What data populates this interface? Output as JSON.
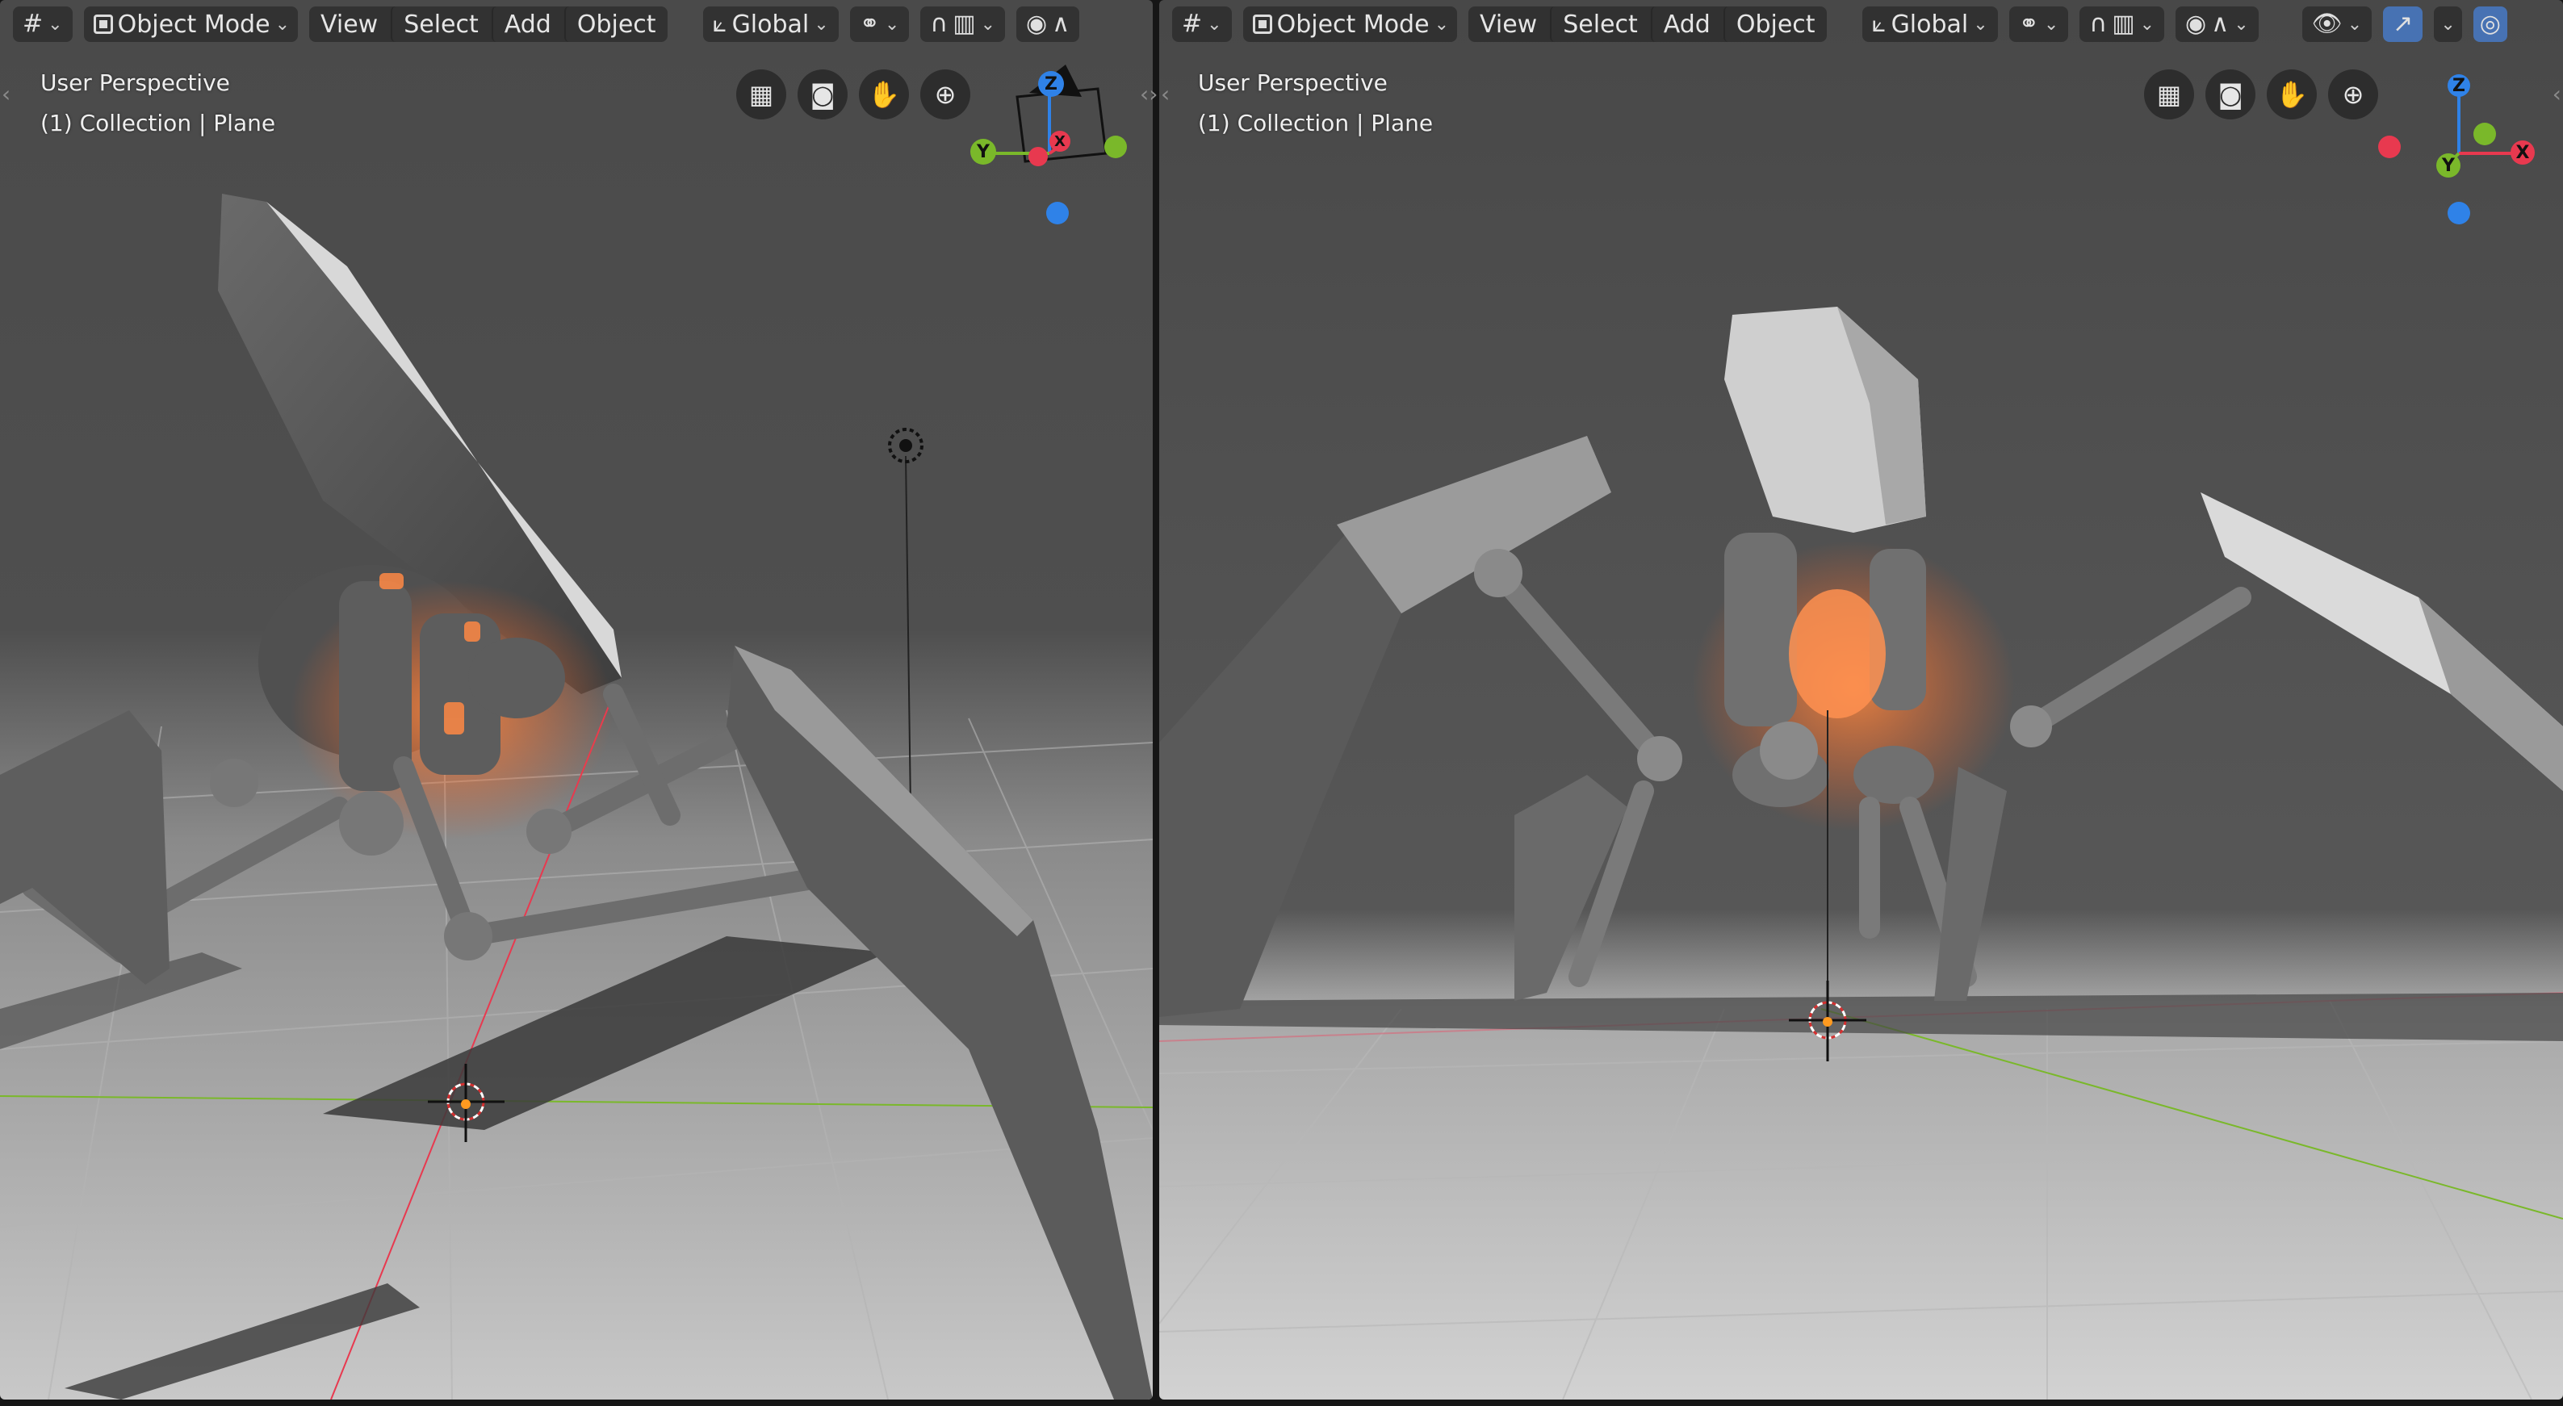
{
  "viewports": {
    "left": {
      "header": {
        "editor_icon": "grid-editor-icon",
        "mode_label": "Object Mode",
        "menus": [
          "View",
          "Select",
          "Add",
          "Object"
        ],
        "orientation_label": "Global"
      },
      "overlay": {
        "view_name": "User Perspective",
        "collection_info": "(1) Collection | Plane"
      },
      "gizmo": {
        "z": "Z",
        "y": "Y",
        "x": "X"
      }
    },
    "right": {
      "header": {
        "editor_icon": "grid-editor-icon",
        "mode_label": "Object Mode",
        "menus": [
          "View",
          "Select",
          "Add",
          "Object"
        ],
        "orientation_label": "Global"
      },
      "overlay": {
        "view_name": "User Perspective",
        "collection_info": "(1) Collection | Plane"
      },
      "gizmo": {
        "z": "Z",
        "y": "Y",
        "x": "X"
      }
    }
  },
  "colors": {
    "axis_x": "#e8394f",
    "axis_y": "#7ab82a",
    "axis_z": "#2f82e8",
    "header_bg": "#303030",
    "active_button": "#4772b3",
    "glow": "#ff7a3a"
  }
}
